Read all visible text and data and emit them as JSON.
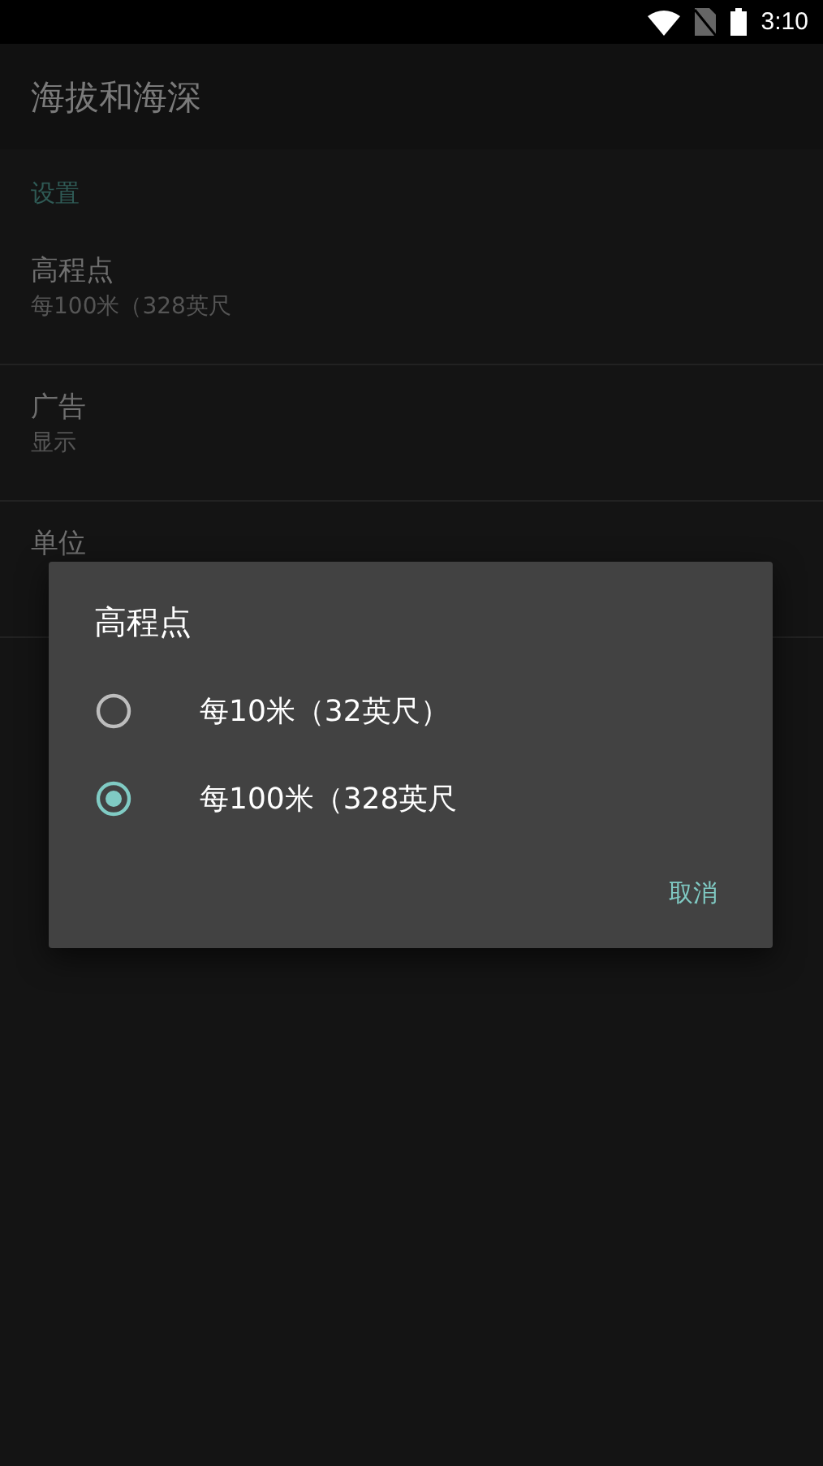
{
  "status_bar": {
    "time": "3:10"
  },
  "toolbar": {
    "title": "海拔和海深"
  },
  "settings": {
    "header": "设置",
    "items": [
      {
        "title": "高程点",
        "summary": "每100米（328英尺"
      },
      {
        "title": "广告",
        "summary": "显示"
      },
      {
        "title": "单位"
      }
    ]
  },
  "dialog": {
    "title": "高程点",
    "options": [
      {
        "label": "每10米（32英尺）",
        "selected": false
      },
      {
        "label": "每100米（328英尺",
        "selected": true
      }
    ],
    "buttons": [
      "取消"
    ]
  }
}
